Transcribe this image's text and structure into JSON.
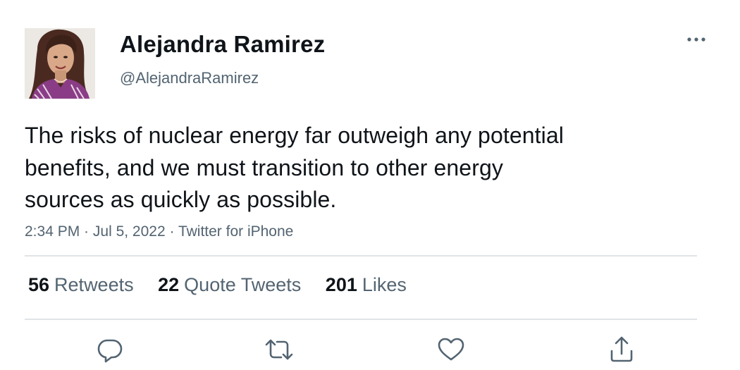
{
  "tweet": {
    "author": {
      "display_name": "Alejandra Ramirez",
      "handle": "@AlejandraRamirez"
    },
    "text_lines": [
      "The risks of nuclear energy far outweigh any potential",
      "benefits, and we must transition to other energy",
      "sources as quickly as possible."
    ],
    "time": "2:34 PM",
    "date": "Jul 5, 2022",
    "separator": " · ",
    "source": "Twitter for iPhone"
  },
  "stats": [
    {
      "count": "56",
      "label": "Retweets"
    },
    {
      "count": "22",
      "label": "Quote Tweets"
    },
    {
      "count": "201",
      "label": "Likes"
    }
  ],
  "actions": {
    "reply_icon": "reply-icon",
    "retweet_icon": "retweet-icon",
    "like_icon": "like-icon",
    "share_icon": "share-icon",
    "more_icon": "more-icon"
  },
  "colors": {
    "text_primary": "#0f1419",
    "text_secondary": "#536471",
    "divider": "#e1e4e6"
  }
}
